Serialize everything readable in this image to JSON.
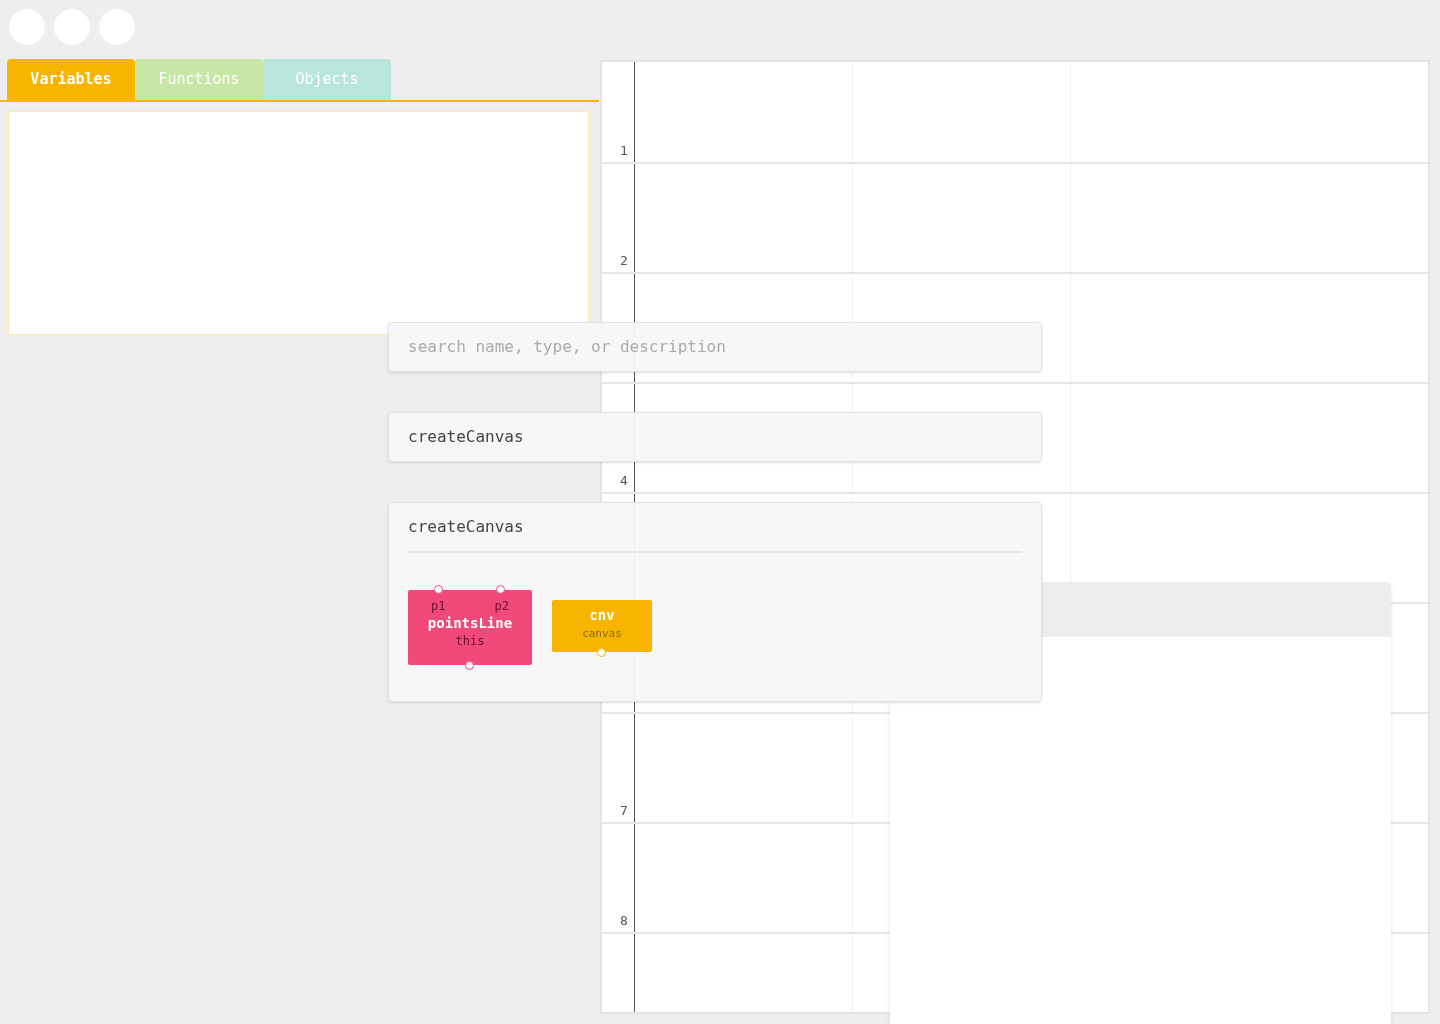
{
  "window_controls": [
    {
      "kind": "dot"
    },
    {
      "kind": "dot"
    },
    {
      "kind": "dot"
    }
  ],
  "tabs": [
    {
      "label": "Variables",
      "selected": true,
      "color": "#f7b500"
    },
    {
      "label": "Functions",
      "selected": false,
      "color": "#c8e6a6"
    },
    {
      "label": "Objects",
      "selected": false,
      "color": "#b8e6dc"
    }
  ],
  "grid": {
    "rows": [
      {
        "number": "1"
      },
      {
        "number": "2"
      },
      {},
      {
        "number": "4"
      },
      {},
      {},
      {
        "number": "7"
      },
      {
        "number": "8"
      }
    ]
  },
  "search": {
    "placeholder": "search name, type, or description"
  },
  "results": [
    {
      "name": "createCanvas"
    }
  ],
  "detail": {
    "title": "createCanvas",
    "nodes": [
      {
        "kind": "function",
        "name": "pointsLine",
        "inputs": [
          "p1",
          "p2"
        ],
        "output": "this",
        "color": "#f0497a"
      },
      {
        "kind": "variable",
        "name": "cnv",
        "type": "canvas",
        "color": "#f7b500"
      }
    ]
  }
}
